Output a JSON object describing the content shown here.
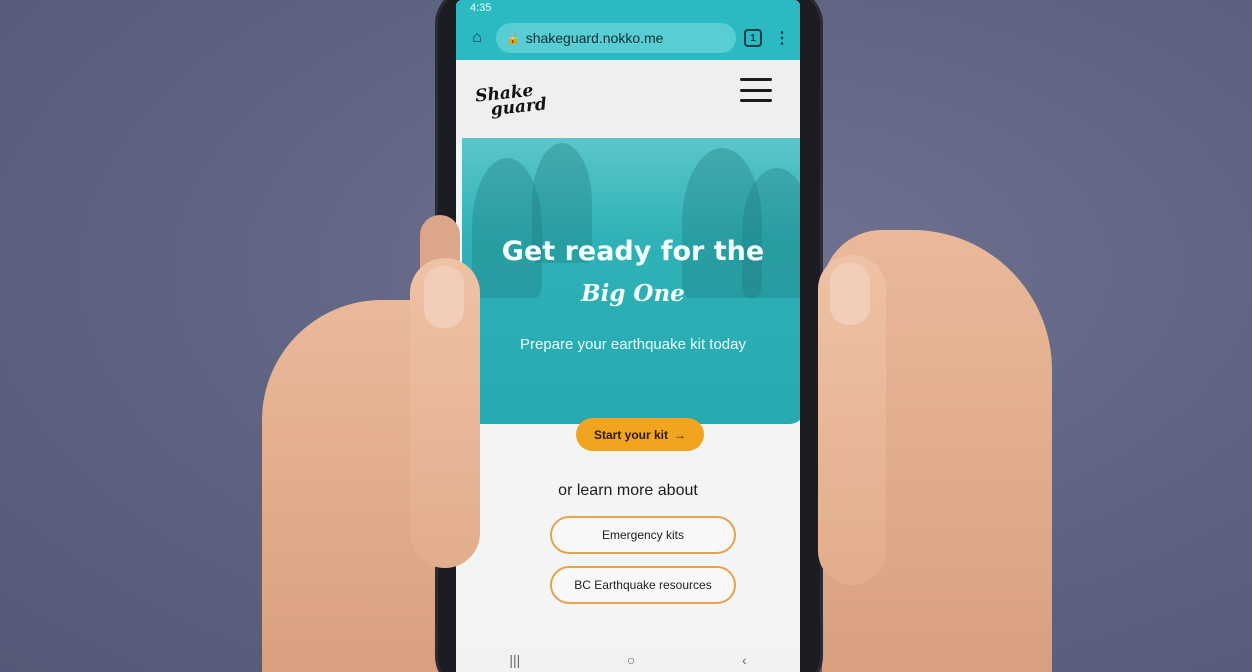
{
  "status_bar": {
    "time": "4:35"
  },
  "browser": {
    "url": "shakeguard.nokko.me",
    "tab_count": "1",
    "menu_glyph": "⋮",
    "home_glyph": "⌂",
    "lock_glyph": "🔒"
  },
  "site": {
    "logo_line1": "Shake",
    "logo_line2": "guard",
    "hero": {
      "title": "Get ready for the",
      "subtitle": "Big One",
      "tagline": "Prepare your earthquake kit today"
    },
    "cta": {
      "label": "Start your kit",
      "arrow": "→"
    },
    "learn_more": "or learn more about",
    "links": [
      "Emergency kits",
      "BC Earthquake resources"
    ]
  },
  "android_nav": {
    "recents": "|||",
    "home": "○",
    "back": "‹"
  },
  "colors": {
    "accent_teal": "#2bbac2",
    "cta_orange": "#f0a41f",
    "pill_border": "#e6a24a"
  }
}
